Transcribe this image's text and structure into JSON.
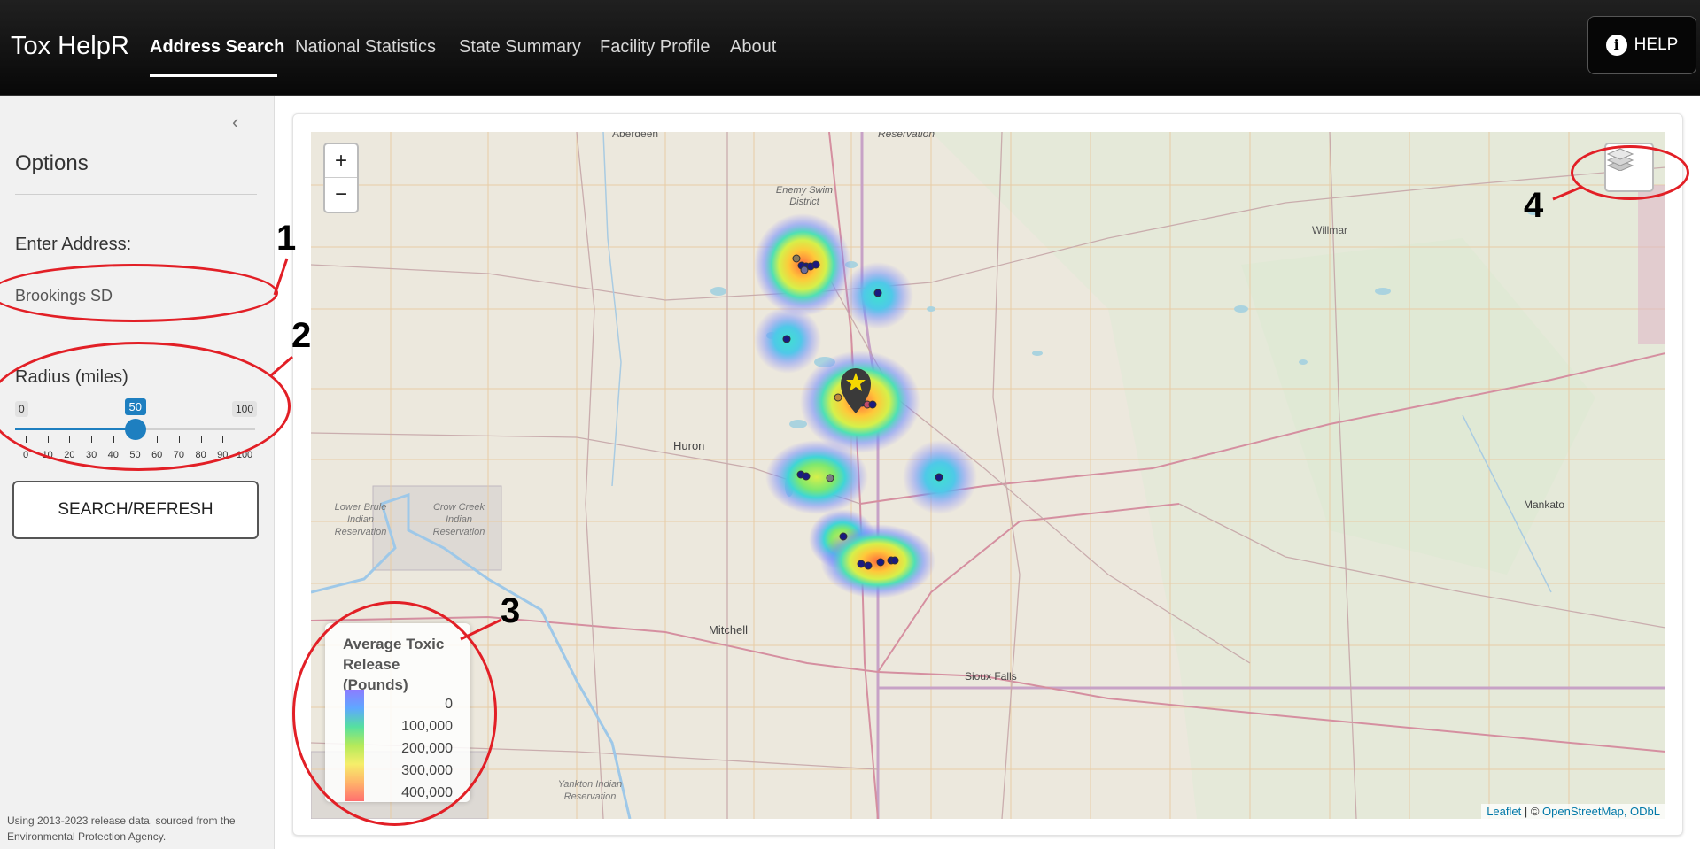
{
  "navbar": {
    "brand": "Tox HelpR",
    "items": [
      "Address Search",
      "National Statistics",
      "State Summary",
      "Facility Profile",
      "About"
    ],
    "active": "Address Search",
    "help_label": "HELP",
    "help_icon": "info-circle-icon"
  },
  "sidebar": {
    "collapse_icon": "chevron-left-icon",
    "title": "Options",
    "address_label": "Enter Address:",
    "address_value": "Brookings SD",
    "radius_label": "Radius (miles)",
    "radius_min": "0",
    "radius_max": "100",
    "radius_value": "50",
    "radius_fraction": 0.5,
    "ticks": [
      "0",
      "10",
      "20",
      "30",
      "40",
      "50",
      "60",
      "70",
      "80",
      "90",
      "100"
    ],
    "search_button": "SEARCH/REFRESH",
    "footer": "Using 2013-2023 release data, sourced from the Environmental Protection Agency."
  },
  "map": {
    "zoom_in": "+",
    "zoom_out": "−",
    "layers_icon": "layers-icon",
    "marker_icon": "star-pin-icon",
    "place_labels": [
      "Aberdeen",
      "Reservation",
      "Enemy Swim District",
      "Willmar",
      "Huron",
      "Lower Brule Indian Reservation",
      "Crow Creek Indian Reservation",
      "Mitchell",
      "Sioux Falls",
      "Yankton Indian Reservation",
      "Mankato"
    ],
    "legend": {
      "title": "Average Toxic Release (Pounds)",
      "labels": [
        "0",
        "100,000",
        "200,000",
        "300,000",
        "400,000"
      ]
    },
    "attribution": {
      "leaflet": "Leaflet",
      "separator": " | © ",
      "osm": "OpenStreetMap",
      "more": ", ODbL"
    }
  },
  "annotations": [
    "1",
    "2",
    "3",
    "4"
  ],
  "colors": {
    "navbar": "#0b0b0b",
    "accent": "#1e7fc0",
    "annotation_ring": "#e21f26"
  }
}
